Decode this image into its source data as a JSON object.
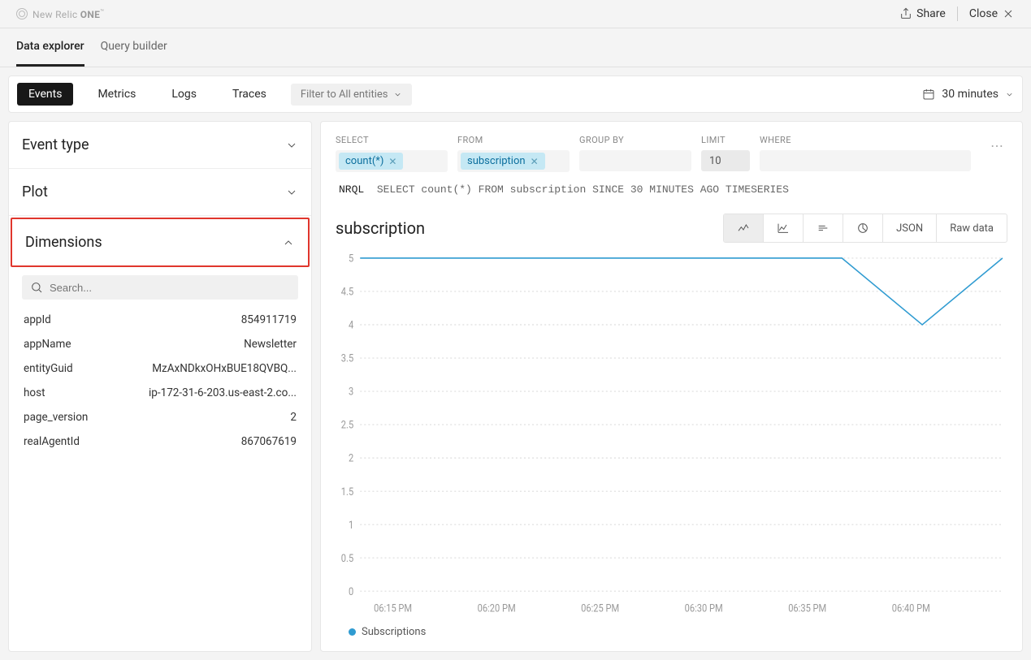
{
  "brand": {
    "prefix": "New Relic ",
    "bold": "ONE",
    "tm": "™"
  },
  "topbar": {
    "share": "Share",
    "close": "Close"
  },
  "nav_tabs": {
    "data_explorer": "Data explorer",
    "query_builder": "Query builder"
  },
  "toolbar": {
    "events": "Events",
    "metrics": "Metrics",
    "logs": "Logs",
    "traces": "Traces",
    "filter": "Filter to All entities",
    "time": "30 minutes"
  },
  "sidebar": {
    "event_type": "Event type",
    "plot": "Plot",
    "dimensions": "Dimensions",
    "search_placeholder": "Search...",
    "dims": [
      {
        "key": "appId",
        "value": "854911719"
      },
      {
        "key": "appName",
        "value": "Newsletter"
      },
      {
        "key": "entityGuid",
        "value": "MzAxNDkxOHxBUE18QVBQ..."
      },
      {
        "key": "host",
        "value": "ip-172-31-6-203.us-east-2.co..."
      },
      {
        "key": "page_version",
        "value": "2"
      },
      {
        "key": "realAgentId",
        "value": "867067619"
      }
    ]
  },
  "query": {
    "select_label": "SELECT",
    "from_label": "FROM",
    "groupby_label": "GROUP BY",
    "limit_label": "LIMIT",
    "where_label": "WHERE",
    "select_chip": "count(*)",
    "from_chip": "subscription",
    "limit_value": "10",
    "nrql_prefix": "NRQL",
    "nrql_text": "SELECT count(*) FROM subscription SINCE 30 MINUTES AGO TIMESERIES"
  },
  "chart": {
    "title": "subscription",
    "json_btn": "JSON",
    "raw_btn": "Raw data",
    "legend": "Subscriptions",
    "y_ticks": [
      "5",
      "4.5",
      "4",
      "3.5",
      "3",
      "2.5",
      "2",
      "1.5",
      "1",
      "0.5",
      "0"
    ],
    "x_ticks": [
      "06:15 PM",
      "06:20 PM",
      "06:25 PM",
      "06:30 PM",
      "06:35 PM",
      "06:40 PM"
    ]
  },
  "chart_data": {
    "type": "line",
    "title": "subscription",
    "xlabel": "",
    "ylabel": "",
    "ylim": [
      0,
      5
    ],
    "x": [
      "06:12 PM",
      "06:15 PM",
      "06:20 PM",
      "06:25 PM",
      "06:30 PM",
      "06:35 PM",
      "06:40 PM",
      "06:41 PM",
      "06:42 PM"
    ],
    "series": [
      {
        "name": "Subscriptions",
        "values": [
          5,
          5,
          5,
          5,
          5,
          5,
          5,
          4,
          5
        ]
      }
    ]
  }
}
